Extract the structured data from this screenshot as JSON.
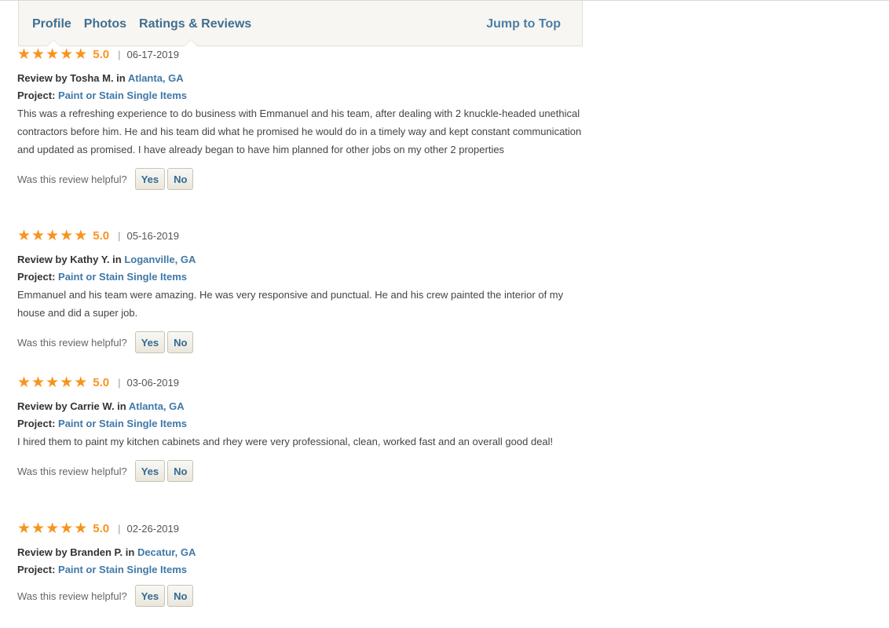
{
  "subnav": {
    "tabs": [
      {
        "label": "Profile"
      },
      {
        "label": "Photos"
      },
      {
        "label": "Ratings & Reviews"
      }
    ],
    "jump_to_top": "Jump to Top"
  },
  "reviews": [
    {
      "rating": "5.0",
      "stars": 5,
      "date": "06-17-2019",
      "reviewer": "Review by Tosha M. in",
      "location": "Atlanta, GA",
      "project_label": "Project:",
      "project_name": "Paint or Stain Single Items",
      "text": "This was a refreshing experience to do business with Emmanuel and his team, after dealing with 2 knuckle-headed unethical contractors before him. He and his team did what he promised he would do in a timely way and kept constant communication and updated as promised. I have already began to have him planned for other jobs on my other 2 properties",
      "helpful_prompt": "Was this review helpful?",
      "yes_label": "Yes",
      "no_label": "No"
    },
    {
      "rating": "5.0",
      "stars": 5,
      "date": "05-16-2019",
      "reviewer": "Review by Kathy Y. in",
      "location": "Loganville, GA",
      "project_label": "Project:",
      "project_name": "Paint or Stain Single Items",
      "text": "Emmanuel and his team were amazing. He was very responsive and punctual. He and his crew painted the interior of my house and did a super job.",
      "helpful_prompt": "Was this review helpful?",
      "yes_label": "Yes",
      "no_label": "No"
    },
    {
      "rating": "5.0",
      "stars": 5,
      "date": "03-06-2019",
      "reviewer": "Review by Carrie W. in",
      "location": "Atlanta, GA",
      "project_label": "Project:",
      "project_name": "Paint or Stain Single Items",
      "text": "I hired them to paint my kitchen cabinets and rhey were very professional, clean, worked fast and an overall good deal!",
      "helpful_prompt": "Was this review helpful?",
      "yes_label": "Yes",
      "no_label": "No"
    },
    {
      "rating": "5.0",
      "stars": 5,
      "date": "02-26-2019",
      "reviewer": "Review by Branden P. in",
      "location": "Decatur, GA",
      "project_label": "Project:",
      "project_name": "Paint or Stain Single Items",
      "text": "",
      "helpful_prompt": "Was this review helpful?",
      "yes_label": "Yes",
      "no_label": "No"
    }
  ]
}
